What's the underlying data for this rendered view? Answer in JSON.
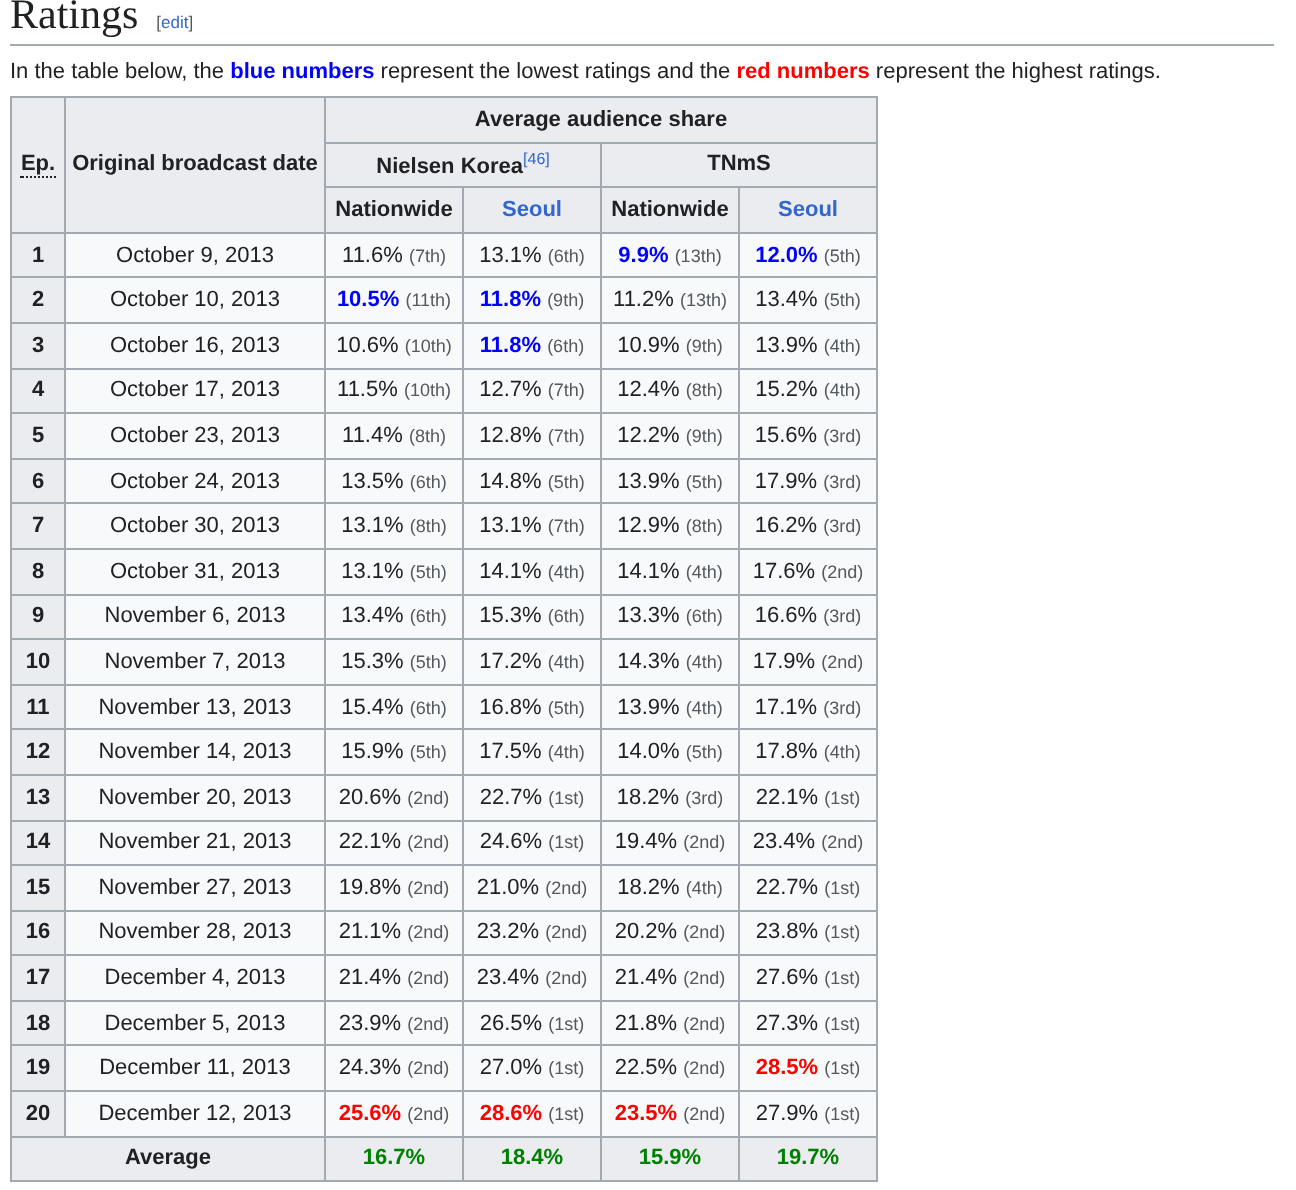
{
  "heading": {
    "title": "Ratings",
    "bracket_open": "[",
    "edit_link": "edit",
    "bracket_close": "]"
  },
  "intro": "In the table below, the **blue numbers** represent the lowest ratings and the **red numbers** represent the highest ratings.",
  "table": {
    "header": {
      "ep": "Ep.",
      "date": "Original broadcast date",
      "group": "Average audience share",
      "sources": [
        {
          "name": "Nielsen Korea",
          "ref": "[46]"
        },
        {
          "name": "TNmS"
        }
      ],
      "columns": [
        {
          "label": "Nationwide",
          "link": false
        },
        {
          "label": "Seoul",
          "link": true
        },
        {
          "label": "Nationwide",
          "link": false
        },
        {
          "label": "Seoul",
          "link": true
        }
      ]
    },
    "rows": [
      {
        "ep": "1",
        "date": "October 9, 2013",
        "cells": [
          {
            "value": "11.6%",
            "rank": "(7th)"
          },
          {
            "value": "13.1%",
            "rank": "(6th)"
          },
          {
            "value": "9.9%",
            "rank": "(13th)",
            "color": "#0000ff"
          },
          {
            "value": "12.0%",
            "rank": "(5th)",
            "color": "#0000ff"
          }
        ]
      },
      {
        "ep": "2",
        "date": "October 10, 2013",
        "cells": [
          {
            "value": "10.5%",
            "rank": "(11th)",
            "color": "#0000ff"
          },
          {
            "value": "11.8%",
            "rank": "(9th)",
            "color": "#0000ff"
          },
          {
            "value": "11.2%",
            "rank": "(13th)"
          },
          {
            "value": "13.4%",
            "rank": "(5th)"
          }
        ]
      },
      {
        "ep": "3",
        "date": "October 16, 2013",
        "cells": [
          {
            "value": "10.6%",
            "rank": "(10th)"
          },
          {
            "value": "11.8%",
            "rank": "(6th)",
            "color": "#0000ff"
          },
          {
            "value": "10.9%",
            "rank": "(9th)"
          },
          {
            "value": "13.9%",
            "rank": "(4th)"
          }
        ]
      },
      {
        "ep": "4",
        "date": "October 17, 2013",
        "cells": [
          {
            "value": "11.5%",
            "rank": "(10th)"
          },
          {
            "value": "12.7%",
            "rank": "(7th)"
          },
          {
            "value": "12.4%",
            "rank": "(8th)"
          },
          {
            "value": "15.2%",
            "rank": "(4th)"
          }
        ]
      },
      {
        "ep": "5",
        "date": "October 23, 2013",
        "cells": [
          {
            "value": "11.4%",
            "rank": "(8th)"
          },
          {
            "value": "12.8%",
            "rank": "(7th)"
          },
          {
            "value": "12.2%",
            "rank": "(9th)"
          },
          {
            "value": "15.6%",
            "rank": "(3rd)"
          }
        ]
      },
      {
        "ep": "6",
        "date": "October 24, 2013",
        "cells": [
          {
            "value": "13.5%",
            "rank": "(6th)"
          },
          {
            "value": "14.8%",
            "rank": "(5th)"
          },
          {
            "value": "13.9%",
            "rank": "(5th)"
          },
          {
            "value": "17.9%",
            "rank": "(3rd)"
          }
        ]
      },
      {
        "ep": "7",
        "date": "October 30, 2013",
        "cells": [
          {
            "value": "13.1%",
            "rank": "(8th)"
          },
          {
            "value": "13.1%",
            "rank": "(7th)"
          },
          {
            "value": "12.9%",
            "rank": "(8th)"
          },
          {
            "value": "16.2%",
            "rank": "(3rd)"
          }
        ]
      },
      {
        "ep": "8",
        "date": "October 31, 2013",
        "cells": [
          {
            "value": "13.1%",
            "rank": "(5th)"
          },
          {
            "value": "14.1%",
            "rank": "(4th)"
          },
          {
            "value": "14.1%",
            "rank": "(4th)"
          },
          {
            "value": "17.6%",
            "rank": "(2nd)"
          }
        ]
      },
      {
        "ep": "9",
        "date": "November 6, 2013",
        "cells": [
          {
            "value": "13.4%",
            "rank": "(6th)"
          },
          {
            "value": "15.3%",
            "rank": "(6th)"
          },
          {
            "value": "13.3%",
            "rank": "(6th)"
          },
          {
            "value": "16.6%",
            "rank": "(3rd)"
          }
        ]
      },
      {
        "ep": "10",
        "date": "November 7, 2013",
        "cells": [
          {
            "value": "15.3%",
            "rank": "(5th)"
          },
          {
            "value": "17.2%",
            "rank": "(4th)"
          },
          {
            "value": "14.3%",
            "rank": "(4th)"
          },
          {
            "value": "17.9%",
            "rank": "(2nd)"
          }
        ]
      },
      {
        "ep": "11",
        "date": "November 13, 2013",
        "cells": [
          {
            "value": "15.4%",
            "rank": "(6th)"
          },
          {
            "value": "16.8%",
            "rank": "(5th)"
          },
          {
            "value": "13.9%",
            "rank": "(4th)"
          },
          {
            "value": "17.1%",
            "rank": "(3rd)"
          }
        ]
      },
      {
        "ep": "12",
        "date": "November 14, 2013",
        "cells": [
          {
            "value": "15.9%",
            "rank": "(5th)"
          },
          {
            "value": "17.5%",
            "rank": "(4th)"
          },
          {
            "value": "14.0%",
            "rank": "(5th)"
          },
          {
            "value": "17.8%",
            "rank": "(4th)"
          }
        ]
      },
      {
        "ep": "13",
        "date": "November 20, 2013",
        "cells": [
          {
            "value": "20.6%",
            "rank": "(2nd)"
          },
          {
            "value": "22.7%",
            "rank": "(1st)"
          },
          {
            "value": "18.2%",
            "rank": "(3rd)"
          },
          {
            "value": "22.1%",
            "rank": "(1st)"
          }
        ]
      },
      {
        "ep": "14",
        "date": "November 21, 2013",
        "cells": [
          {
            "value": "22.1%",
            "rank": "(2nd)"
          },
          {
            "value": "24.6%",
            "rank": "(1st)"
          },
          {
            "value": "19.4%",
            "rank": "(2nd)"
          },
          {
            "value": "23.4%",
            "rank": "(2nd)"
          }
        ]
      },
      {
        "ep": "15",
        "date": "November 27, 2013",
        "cells": [
          {
            "value": "19.8%",
            "rank": "(2nd)"
          },
          {
            "value": "21.0%",
            "rank": "(2nd)"
          },
          {
            "value": "18.2%",
            "rank": "(4th)"
          },
          {
            "value": "22.7%",
            "rank": "(1st)"
          }
        ]
      },
      {
        "ep": "16",
        "date": "November 28, 2013",
        "cells": [
          {
            "value": "21.1%",
            "rank": "(2nd)"
          },
          {
            "value": "23.2%",
            "rank": "(2nd)"
          },
          {
            "value": "20.2%",
            "rank": "(2nd)"
          },
          {
            "value": "23.8%",
            "rank": "(1st)"
          }
        ]
      },
      {
        "ep": "17",
        "date": "December 4, 2013",
        "cells": [
          {
            "value": "21.4%",
            "rank": "(2nd)"
          },
          {
            "value": "23.4%",
            "rank": "(2nd)"
          },
          {
            "value": "21.4%",
            "rank": "(2nd)"
          },
          {
            "value": "27.6%",
            "rank": "(1st)"
          }
        ]
      },
      {
        "ep": "18",
        "date": "December 5, 2013",
        "cells": [
          {
            "value": "23.9%",
            "rank": "(2nd)"
          },
          {
            "value": "26.5%",
            "rank": "(1st)"
          },
          {
            "value": "21.8%",
            "rank": "(2nd)"
          },
          {
            "value": "27.3%",
            "rank": "(1st)"
          }
        ]
      },
      {
        "ep": "19",
        "date": "December 11, 2013",
        "cells": [
          {
            "value": "24.3%",
            "rank": "(2nd)"
          },
          {
            "value": "27.0%",
            "rank": "(1st)"
          },
          {
            "value": "22.5%",
            "rank": "(2nd)"
          },
          {
            "value": "28.5%",
            "rank": "(1st)",
            "color": "#ff0000"
          }
        ]
      },
      {
        "ep": "20",
        "date": "December 12, 2013",
        "cells": [
          {
            "value": "25.6%",
            "rank": "(2nd)",
            "color": "#ff0000"
          },
          {
            "value": "28.6%",
            "rank": "(1st)",
            "color": "#ff0000"
          },
          {
            "value": "23.5%",
            "rank": "(2nd)",
            "color": "#ff0000"
          },
          {
            "value": "27.9%",
            "rank": "(1st)"
          }
        ]
      }
    ],
    "average": {
      "label": "Average",
      "values": [
        "16.7%",
        "18.4%",
        "15.9%",
        "19.7%"
      ]
    }
  }
}
